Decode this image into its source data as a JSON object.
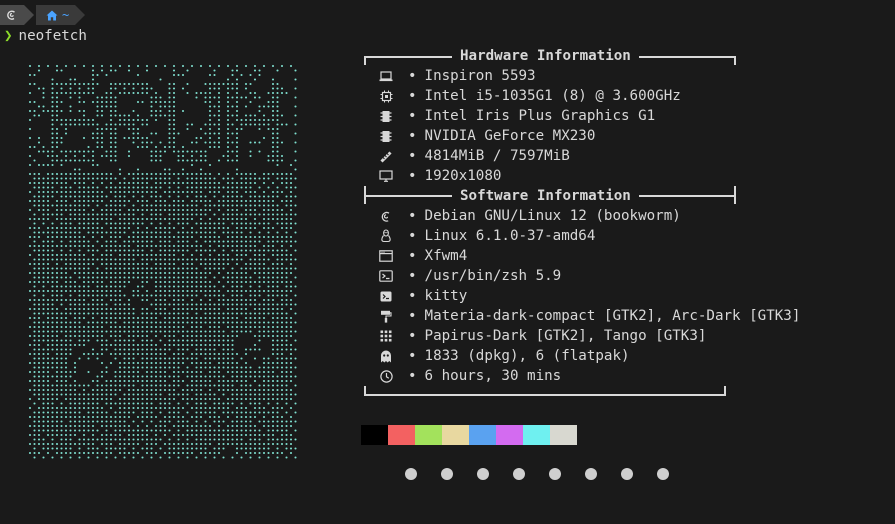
{
  "prompt": {
    "segment1_icon": "debian-swirl-icon",
    "segment2_icon": "home-icon",
    "segment2_text": "~",
    "command": "neofetch",
    "arrow_glyph": "❯",
    "accent": "#8ddc2a"
  },
  "ascii_art": {
    "text": "BRUH",
    "color": "#7fe0d0"
  },
  "hardware": {
    "title": "Hardware Information",
    "rows": [
      {
        "icon": "laptop-icon",
        "value": "Inspiron 5593"
      },
      {
        "icon": "cpu-icon",
        "value": "Intel i5-1035G1 (8) @ 3.600GHz"
      },
      {
        "icon": "chip-icon",
        "value": "Intel Iris Plus Graphics G1"
      },
      {
        "icon": "chip-icon",
        "value": "NVIDIA GeForce MX230"
      },
      {
        "icon": "memory-icon",
        "value": "4814MiB / 7597MiB"
      },
      {
        "icon": "monitor-icon",
        "value": "1920x1080"
      }
    ]
  },
  "software": {
    "title": "Software Information",
    "rows": [
      {
        "icon": "debian-icon",
        "value": "Debian GNU/Linux 12 (bookworm)"
      },
      {
        "icon": "linux-tux-icon",
        "value": "Linux 6.1.0-37-amd64"
      },
      {
        "icon": "window-icon",
        "value": "Xfwm4"
      },
      {
        "icon": "terminal-icon",
        "value": "/usr/bin/zsh 5.9"
      },
      {
        "icon": "terminal-small-icon",
        "value": "kitty"
      },
      {
        "icon": "paint-roller-icon",
        "value": "Materia-dark-compact [GTK2], Arc-Dark [GTK3]"
      },
      {
        "icon": "grid-icon",
        "value": "Papirus-Dark [GTK2], Tango [GTK3]"
      },
      {
        "icon": "ghost-icon",
        "value": "1833 (dpkg), 6 (flatpak)"
      },
      {
        "icon": "clock-icon",
        "value": "6 hours, 30 mins"
      }
    ]
  },
  "bullet": "•",
  "palette": [
    "#000000",
    "#f36161",
    "#a3e25c",
    "#e8d8a0",
    "#5aa2f0",
    "#d36bf0",
    "#6ff0f0",
    "#d8d8d0"
  ],
  "dots_color": "#cfcfcf",
  "dots": [
    "●",
    "●",
    "●",
    "●",
    "●",
    "●",
    "●",
    "●"
  ]
}
